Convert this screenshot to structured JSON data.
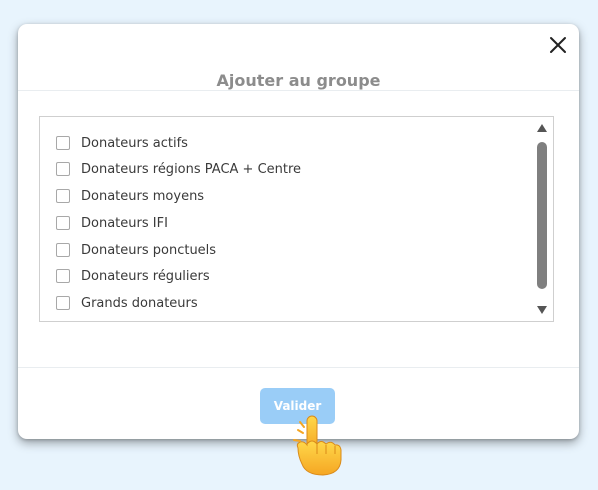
{
  "dialog": {
    "title": "Ajouter au groupe",
    "groups": [
      {
        "label": "Donateurs actifs",
        "checked": false
      },
      {
        "label": "Donateurs régions PACA + Centre",
        "checked": false
      },
      {
        "label": "Donateurs moyens",
        "checked": false
      },
      {
        "label": "Donateurs IFI",
        "checked": false
      },
      {
        "label": "Donateurs ponctuels",
        "checked": false
      },
      {
        "label": "Donateurs réguliers",
        "checked": false
      },
      {
        "label": "Grands donateurs",
        "checked": false
      }
    ],
    "submit_label": "Valider"
  },
  "colors": {
    "page_background": "#e8f4fd",
    "title_text": "#8c8c8c",
    "submit_button": "#9acdf7",
    "scroll_thumb": "#7f7f7f"
  }
}
